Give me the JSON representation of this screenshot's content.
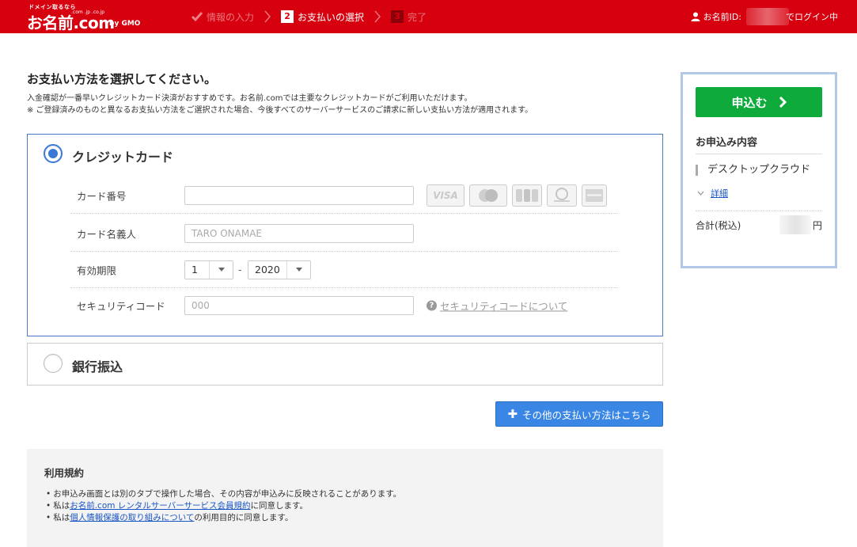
{
  "header": {
    "logo_tagline": "ドメイン取るなら",
    "logo_name": "お名前.com",
    "logo_sub": ".com .jp .co.jp",
    "logo_by": "by GMO",
    "steps": [
      {
        "label": "情報の入力",
        "state": "done"
      },
      {
        "number": "2",
        "label": "お支払いの選択",
        "state": "current"
      },
      {
        "number": "3",
        "label": "完了",
        "state": "todo"
      }
    ],
    "user_label": "お名前ID:",
    "login_status": "でログイン中"
  },
  "main": {
    "title": "お支払い方法を選択してください。",
    "desc_line1": "入金確認が一番早いクレジットカード決済がおすすめです。お名前.comでは主要なクレジットカードがご利用いただけます。",
    "desc_line2": "※ ご登録済みのものと異なるお支払い方法をご選択された場合、今後すべてのサーバーサービスのご請求に新しい支払い方法が適用されます。"
  },
  "credit": {
    "title": "クレジットカード",
    "selected": true,
    "card_number_label": "カード番号",
    "card_number_value": "",
    "card_brands": [
      "VISA",
      "MasterCard",
      "JCB",
      "Diners Club",
      "AMEX"
    ],
    "holder_label": "カード名義人",
    "holder_placeholder": "TARO ONAMAE",
    "expiry_label": "有効期限",
    "expiry_month": "1",
    "expiry_sep": "-",
    "expiry_year": "2020",
    "security_label": "セキュリティコード",
    "security_placeholder": "000",
    "security_help": "セキュリティコードについて"
  },
  "bank": {
    "title": "銀行振込",
    "selected": false
  },
  "other_methods_label": "その他の支払い方法はこちら",
  "terms": {
    "title": "利用規約",
    "item1": "お申込み画面とは別のタブで操作した場合、その内容が申込みに反映されることがあります。",
    "item2_prefix": "私は",
    "item2_link": "お名前.com レンタルサーバーサービス会員規約",
    "item2_suffix": "に同意します。",
    "item3_prefix": "私は",
    "item3_link": "個人情報保護の取り組みについて",
    "item3_suffix": "の利用目的に同意します。"
  },
  "sidebar": {
    "apply_label": "申込む",
    "summary_title": "お申込み内容",
    "product": "デスクトップクラウド",
    "detail_link": "詳細",
    "total_label": "合計(税込)",
    "total_unit": "円"
  },
  "colors": {
    "header_red": "#d7000f",
    "apply_green": "#0eab3c",
    "accent_blue": "#3a78d8"
  }
}
